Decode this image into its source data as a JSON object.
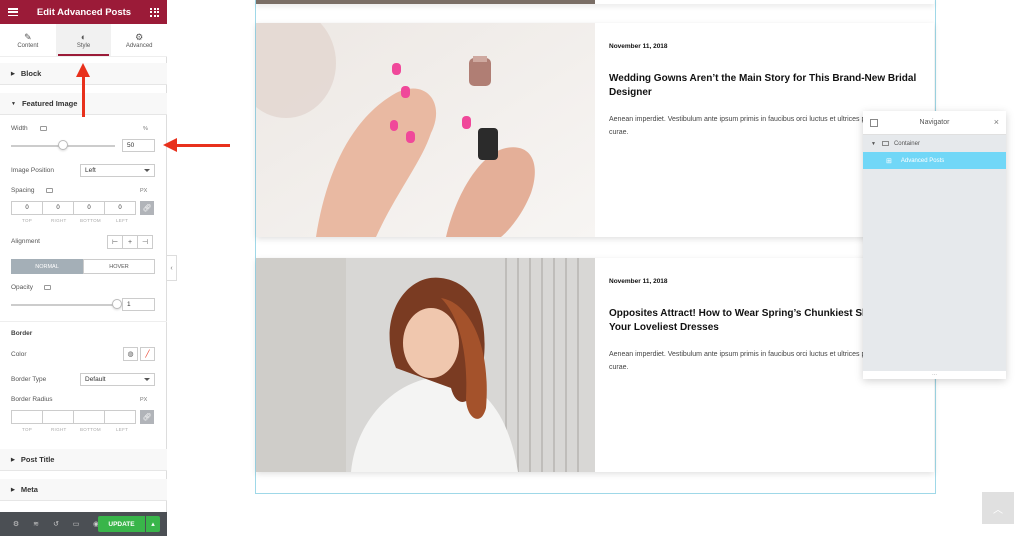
{
  "panel": {
    "title": "Edit Advanced Posts",
    "tabs": [
      {
        "label": "Content",
        "icon": "pencil-icon"
      },
      {
        "label": "Style",
        "icon": "half-circle-icon"
      },
      {
        "label": "Advanced",
        "icon": "gear-icon"
      }
    ],
    "active_tab": "Style",
    "sections": {
      "block": "Block",
      "featured_image": "Featured Image",
      "post_title": "Post Title",
      "meta": "Meta"
    },
    "featured_image": {
      "width_label": "Width",
      "width_unit": "%",
      "width_value": "50",
      "width_slider_fraction": 0.5,
      "image_position_label": "Image Position",
      "image_position_value": "Left",
      "spacing_label": "Spacing",
      "spacing_unit": "PX",
      "spacing_values": [
        "0",
        "0",
        "0",
        "0"
      ],
      "spacing_sides": [
        "TOP",
        "RIGHT",
        "BOTTOM",
        "LEFT"
      ],
      "alignment_label": "Alignment",
      "toggle_normal": "NORMAL",
      "toggle_hover": "HOVER",
      "opacity_label": "Opacity",
      "opacity_value": "1",
      "opacity_slider_fraction": 1.0,
      "border_heading": "Border",
      "color_label": "Color",
      "border_type_label": "Border Type",
      "border_type_value": "Default",
      "border_radius_label": "Border Radius",
      "border_radius_unit": "PX",
      "radius_sides": [
        "TOP",
        "RIGHT",
        "BOTTOM",
        "LEFT"
      ]
    },
    "footer": {
      "update_label": "UPDATE"
    }
  },
  "posts": [
    {
      "date": "November 11, 2018",
      "title": "Wedding Gowns Aren’t the Main Story for This Brand-New Bridal Designer",
      "excerpt": "Aenean imperdiet. Vestibulum ante ipsum primis in faucibus orci luctus et ultrices posuere cubilia curae."
    },
    {
      "date": "November 11, 2018",
      "title": "Opposites Attract! How to Wear Spring’s Chunkiest Shoes With Your Loveliest Dresses",
      "excerpt": "Aenean imperdiet. Vestibulum ante ipsum primis in faucibus orci luctus et ultrices posuere cubilia curae."
    }
  ],
  "navigator": {
    "title": "Navigator",
    "items": [
      {
        "label": "Container"
      },
      {
        "label": "Advanced Posts",
        "selected": true
      }
    ],
    "footer_glyph": "..."
  },
  "colors": {
    "brand": "#9b1b38",
    "update": "#39b54a",
    "selected": "#71d7f7",
    "annotation_arrow": "#e8311c"
  }
}
